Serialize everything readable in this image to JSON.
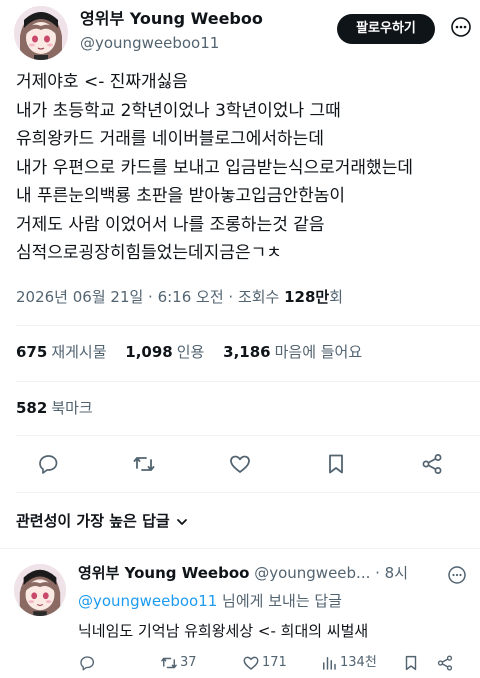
{
  "author": {
    "display_name": "영위부 Young Weeboo",
    "handle": "@youngweeboo11",
    "follow_label": "팔로우하기"
  },
  "tweet": {
    "lines": [
      "거제야호 <- 진짜개싫음",
      "내가 초등학교 2학년이었나 3학년이었나 그때",
      "유희왕카드 거래를 네이버블로그에서하는데",
      "내가 우편으로 카드를 보내고 입금받는식으로거래했는데",
      "내 푸른눈의백룡 초판을 받아놓고입금안한놈이",
      "거제도 사람 이었어서 나를 조롱하는것 같음",
      "심적으로굉장히힘들었는데지금은ㄱㅊ"
    ],
    "timestamp": "2026년 06월 21일 · 6:16 오전 · 조회수 ",
    "views": "128만",
    "views_suffix": "회"
  },
  "stats": {
    "reposts": "675",
    "reposts_label": "재게시물",
    "likes": "1,098",
    "likes_label": "인용",
    "hearts": "3,186",
    "hearts_label": "마음에 들어요",
    "bookmarks": "582",
    "bookmarks_label": "북마크"
  },
  "actions": {
    "icons": [
      "reply-icon",
      "retweet-icon",
      "heart-icon",
      "bookmark-icon",
      "share-icon"
    ]
  },
  "sort": {
    "label": "관련성이 가장 높은 답글"
  },
  "reply": {
    "display_name": "영위부 Young Weeboo",
    "handle": "@youngweeb...",
    "time": "· 8시",
    "mention": "@youngweeboo11",
    "replying_suffix": " 님에게 보내는 답글",
    "text": "닉네임도 기억남 유희왕세상 <- 희대의 씨벌새",
    "retweets": "37",
    "likes": "171",
    "views": "134천"
  },
  "colors": {
    "text": "#0f1419",
    "secondary": "#536471",
    "accent": "#1d9bf0",
    "divider": "#eff3f4"
  }
}
